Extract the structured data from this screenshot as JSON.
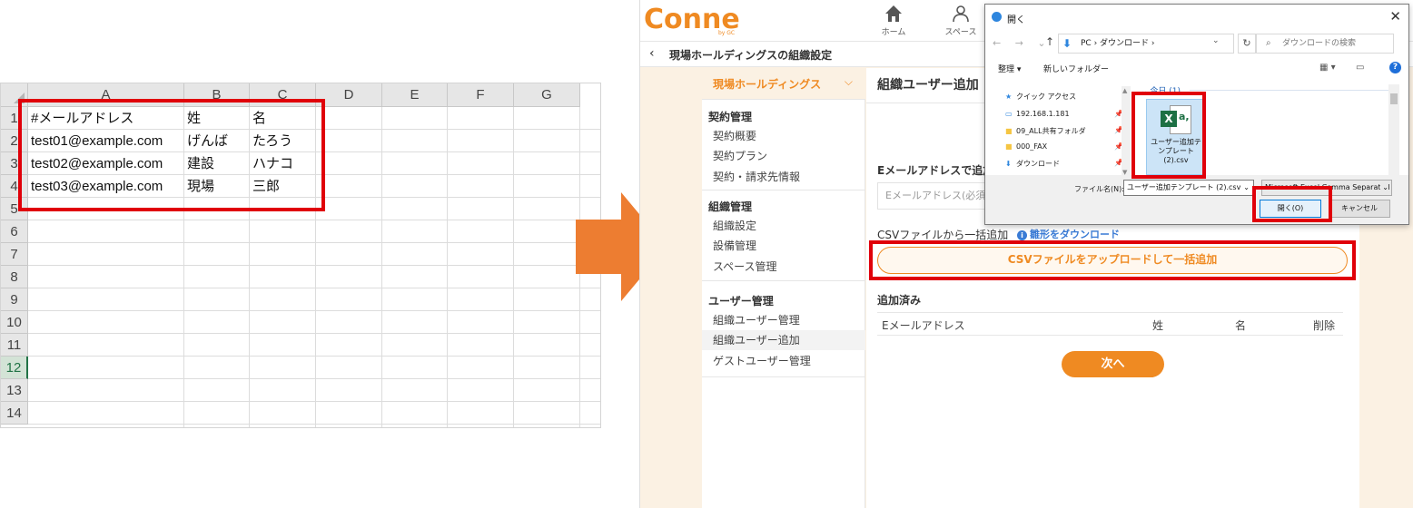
{
  "spreadsheet": {
    "columns": [
      "A",
      "B",
      "C",
      "D",
      "E",
      "F",
      "G"
    ],
    "rows": [
      "1",
      "2",
      "3",
      "4",
      "5",
      "6",
      "7",
      "8",
      "9",
      "10",
      "11",
      "12",
      "13",
      "14"
    ],
    "selected_row": "12",
    "cells": [
      [
        "#メールアドレス",
        "姓",
        "名"
      ],
      [
        "test01@example.com",
        "げんば",
        "たろう"
      ],
      [
        "test02@example.com",
        "建設",
        "ハナコ"
      ],
      [
        "test03@example.com",
        "現場",
        "三郎"
      ]
    ]
  },
  "app": {
    "logo": "Conne",
    "logo_sub": "by GC",
    "nav": {
      "home": "ホーム",
      "space": "スペース"
    },
    "breadcrumb_title": "現場ホールディングスの組織設定",
    "org_name": "現場ホールディングス",
    "sidebar": {
      "contract_header": "契約管理",
      "contract_items": [
        "契約概要",
        "契約プラン",
        "契約・請求先情報"
      ],
      "org_header": "組織管理",
      "org_items": [
        "組織設定",
        "設備管理",
        "スペース管理"
      ],
      "user_header": "ユーザー管理",
      "user_items": [
        "組織ユーザー管理",
        "組織ユーザー追加",
        "ゲストユーザー管理"
      ],
      "active_item": "組織ユーザー追加"
    },
    "main": {
      "title": "組織ユーザー追加",
      "email_section_label": "Eメールアドレスで追加",
      "email_placeholder": "Eメールアドレス(必須)",
      "csv_section_label": "CSVファイルから一括追加",
      "template_link": "雛形をダウンロード",
      "csv_button": "CSVファイルをアップロードして一括追加",
      "added_label": "追加済み",
      "table_headers": {
        "email": "Eメールアドレス",
        "last": "姓",
        "first": "名",
        "delete": "削除"
      },
      "next_button": "次へ"
    },
    "accent_color": "#ef8a22"
  },
  "dialog": {
    "title": "開く",
    "path": "PC › ダウンロード ›",
    "search_placeholder": "ダウンロードの検索",
    "organize": "整理 ▾",
    "new_folder": "新しいフォルダー",
    "nav_items": [
      {
        "icon": "star-icon",
        "label": "クイック アクセス"
      },
      {
        "icon": "computer-icon",
        "label": "192.168.1.181"
      },
      {
        "icon": "folder-icon",
        "label": "09_ALL共有フォルダ"
      },
      {
        "icon": "folder-icon",
        "label": "000_FAX"
      },
      {
        "icon": "download-icon",
        "label": "ダウンロード"
      }
    ],
    "group_label": "今日 (1)",
    "file_name": "ユーザー追加テンプレート(2).csv",
    "filename_label": "ファイル名(N):",
    "filename_value": "ユーザー追加テンプレート (2).csv",
    "file_type": "Microsoft Excel Comma Separated",
    "open_button": "開く(O)",
    "cancel_button": "キャンセル"
  }
}
